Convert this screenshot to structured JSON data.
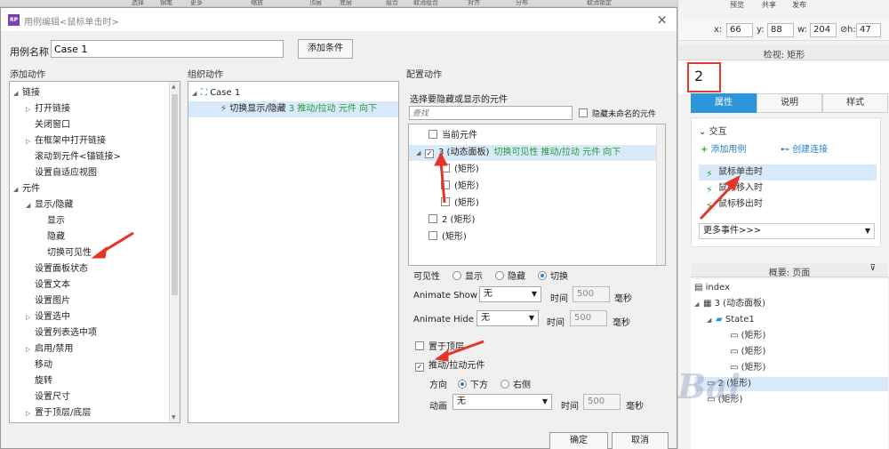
{
  "top_strip": [
    "选择",
    "钢笔",
    "更多",
    "缩放",
    "顶层",
    "底层",
    "组合",
    "取消组合",
    "对齐",
    "分布",
    "取消锁定"
  ],
  "right_menu": [
    "预览",
    "共享",
    "发布"
  ],
  "coords": {
    "x_label": "x:",
    "x": "66",
    "y_label": "y:",
    "y": "88",
    "w_label": "w:",
    "w": "204",
    "h_label": "h:",
    "h": "47"
  },
  "inspector": {
    "title": "检视: 矩形",
    "name_value": "2",
    "tabs": [
      "属性",
      "说明",
      "样式"
    ],
    "section": "交互",
    "add_case": "添加用例",
    "create_link": "创建连接",
    "events": [
      "鼠标单击时",
      "鼠标移入时",
      "鼠标移出时"
    ],
    "more_events": "更多事件>>>"
  },
  "outline": {
    "title": "概要: 页面",
    "rows": [
      "index",
      "3 (动态面板)",
      "State1",
      "(矩形)",
      "(矩形)",
      "(矩形)",
      "2 (矩形)",
      "(矩形)"
    ]
  },
  "watermark": "Bai",
  "dialog": {
    "title": "用例编辑<鼠标单击时>",
    "close": "×",
    "case_name_label": "用例名称",
    "case_name_value": "Case 1",
    "add_condition": "添加条件",
    "col_add_action": "添加动作",
    "col_org_action": "组织动作",
    "col_cfg_action": "配置动作",
    "actions": [
      {
        "label": "链接",
        "level": 0,
        "tri": "◢"
      },
      {
        "label": "打开链接",
        "level": 1,
        "tri": "▷"
      },
      {
        "label": "关闭窗口",
        "level": 1,
        "tri": ""
      },
      {
        "label": "在框架中打开链接",
        "level": 1,
        "tri": "▷"
      },
      {
        "label": "滚动到元件<锚链接>",
        "level": 1,
        "tri": ""
      },
      {
        "label": "设置自适应视图",
        "level": 1,
        "tri": ""
      },
      {
        "label": "元件",
        "level": 0,
        "tri": "◢"
      },
      {
        "label": "显示/隐藏",
        "level": 1,
        "tri": "◢"
      },
      {
        "label": "显示",
        "level": 2,
        "tri": ""
      },
      {
        "label": "隐藏",
        "level": 2,
        "tri": ""
      },
      {
        "label": "切换可见性",
        "level": 2,
        "tri": ""
      },
      {
        "label": "设置面板状态",
        "level": 1,
        "tri": ""
      },
      {
        "label": "设置文本",
        "level": 1,
        "tri": ""
      },
      {
        "label": "设置图片",
        "level": 1,
        "tri": ""
      },
      {
        "label": "设置选中",
        "level": 1,
        "tri": "▷"
      },
      {
        "label": "设置列表选中项",
        "level": 1,
        "tri": ""
      },
      {
        "label": "启用/禁用",
        "level": 1,
        "tri": "▷"
      },
      {
        "label": "移动",
        "level": 1,
        "tri": ""
      },
      {
        "label": "旋转",
        "level": 1,
        "tri": ""
      },
      {
        "label": "设置尺寸",
        "level": 1,
        "tri": ""
      },
      {
        "label": "置于顶层/底层",
        "level": 1,
        "tri": "▷"
      }
    ],
    "org": {
      "case": "Case 1",
      "action_prefix": "切换显示/隐藏",
      "action_detail": "3 推动/拉动 元件 向下"
    },
    "cfg": {
      "select_label": "选择要隐藏或显示的元件",
      "search_placeholder": "查找",
      "hide_unnamed": "隐藏未命名的元件",
      "widgets": [
        {
          "label": "当前元件",
          "detail": "",
          "checked": false,
          "indent": 1
        },
        {
          "label": "3 (动态面板)",
          "detail": "切换可见性 推动/拉动 元件 向下",
          "checked": true,
          "indent": 0
        },
        {
          "label": "(矩形)",
          "detail": "",
          "checked": false,
          "indent": 2
        },
        {
          "label": "(矩形)",
          "detail": "",
          "checked": false,
          "indent": 2
        },
        {
          "label": "(矩形)",
          "detail": "",
          "checked": false,
          "indent": 2
        },
        {
          "label": "2 (矩形)",
          "detail": "",
          "checked": false,
          "indent": 1
        },
        {
          "label": "(矩形)",
          "detail": "",
          "checked": false,
          "indent": 1
        }
      ],
      "visibility_label": "可见性",
      "vis_show": "显示",
      "vis_hide": "隐藏",
      "vis_toggle": "切换",
      "animate_show_label": "Animate Show",
      "animate_show_value": "无",
      "time_label": "时间",
      "time_show_value": "500",
      "ms_label": "毫秒",
      "animate_hide_label": "Animate Hide",
      "animate_hide_value": "无",
      "time_hide_value": "500",
      "bring_front": "置于顶层",
      "push_pull": "推动/拉动元件",
      "direction_label": "方向",
      "dir_down": "下方",
      "dir_right": "右侧",
      "animation_label": "动画",
      "animation_value": "无",
      "time_anim_value": "500"
    },
    "ok": "确定",
    "cancel": "取消"
  },
  "colors": {
    "accent": "#2d96db",
    "selection": "#d8eaf9",
    "highlight": "#e03b2f",
    "green_text": "#2a9a3a"
  }
}
